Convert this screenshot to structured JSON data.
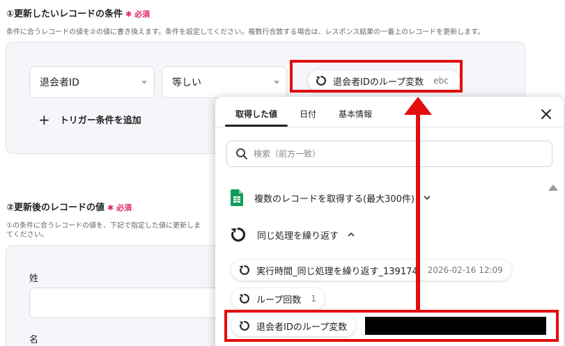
{
  "section1": {
    "title": "①更新したいレコードの条件",
    "required": "✱ 必須",
    "description": "条件に合うレコードの値を②の値に書き換えます。条件を設定してください。複数行合致する場合は、レスポンス結果の一番上のレコードを更新します。",
    "field_select": "退会者ID",
    "operator_select": "等しい",
    "value_chip": {
      "label": "退会者IDのループ変数",
      "sub": "ebc"
    },
    "add_trigger": "トリガー条件を追加"
  },
  "section2": {
    "title": "②更新後のレコードの値",
    "required": "✱ 必須",
    "description_line1": "①の条件に合うレコードの値を、下記で指定した値に更新しま",
    "description_line2": "てください。",
    "field1_label": "姓",
    "field2_label": "名"
  },
  "popup": {
    "tabs": [
      "取得した値",
      "日付",
      "基本情報"
    ],
    "active_tab": 0,
    "search_placeholder": "検索（前方一致）",
    "groups": [
      {
        "label": "複数のレコードを取得する(最大300件)",
        "icon": "google-sheets-icon",
        "expanded": false
      },
      {
        "label": "同じ処理を繰り返す",
        "icon": "loop-icon",
        "expanded": true
      }
    ],
    "items": [
      {
        "label": "実行時間_同じ処理を繰り返す_139174",
        "value": "2026-02-16 12:09"
      },
      {
        "label": "ループ回数",
        "value": "1"
      },
      {
        "label": "退会者IDのループ変数",
        "value": ""
      }
    ]
  },
  "colors": {
    "annotation_red": "#e30d0d",
    "required_red": "#e0245e",
    "sheets_green": "#0f9d58"
  }
}
